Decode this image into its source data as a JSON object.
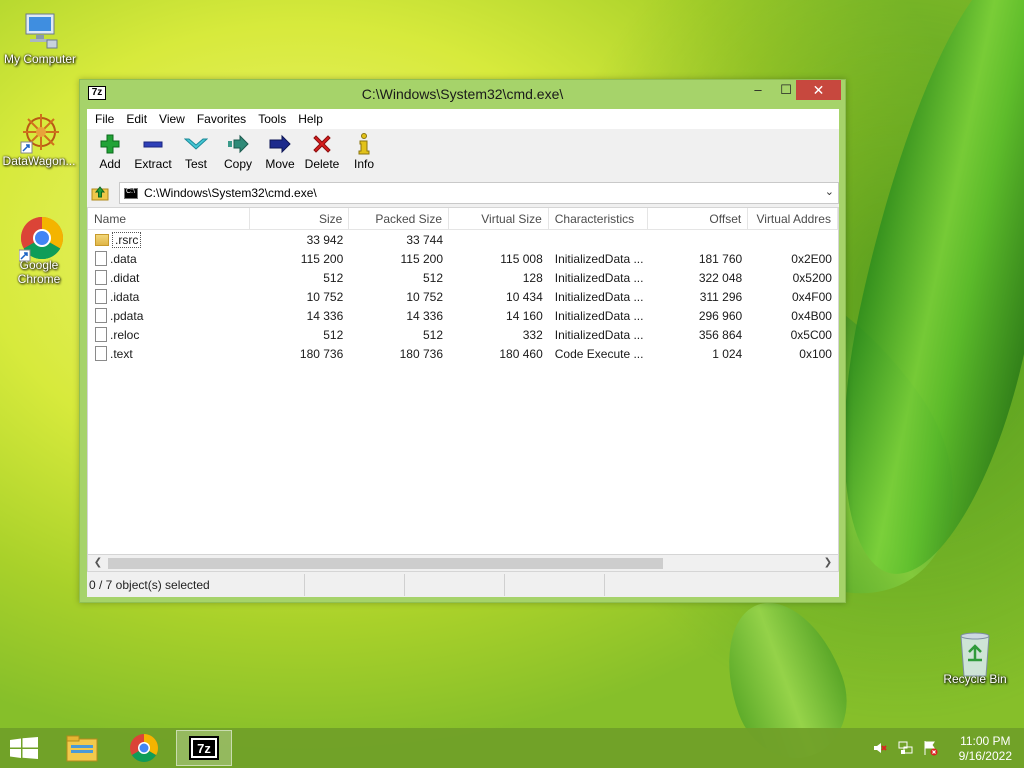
{
  "desktop": {
    "icons": [
      {
        "label": "My Computer"
      },
      {
        "label": "DataWagon..."
      },
      {
        "label": "Google Chrome"
      },
      {
        "label": "Recycle Bin"
      }
    ]
  },
  "window": {
    "title": "C:\\Windows\\System32\\cmd.exe\\",
    "app_icon_text": "7z",
    "controls": {
      "minimize": "–",
      "maximize": "☐",
      "close": "✕"
    }
  },
  "menubar": {
    "items": [
      "File",
      "Edit",
      "View",
      "Favorites",
      "Tools",
      "Help"
    ]
  },
  "toolbar": {
    "buttons": [
      {
        "label": "Add",
        "icon": "plus-icon"
      },
      {
        "label": "Extract",
        "icon": "minus-icon"
      },
      {
        "label": "Test",
        "icon": "check-icon"
      },
      {
        "label": "Copy",
        "icon": "copy-arrow-icon"
      },
      {
        "label": "Move",
        "icon": "move-arrow-icon"
      },
      {
        "label": "Delete",
        "icon": "delete-x-icon"
      },
      {
        "label": "Info",
        "icon": "info-icon"
      }
    ]
  },
  "address": {
    "path": "C:\\Windows\\System32\\cmd.exe\\"
  },
  "listview": {
    "columns": [
      "Name",
      "Size",
      "Packed Size",
      "Virtual Size",
      "Characteristics",
      "Offset",
      "Virtual Addres"
    ],
    "rows": [
      {
        "name": ".rsrc",
        "type": "folder",
        "size": "33 942",
        "packed": "33 744",
        "vsize": "",
        "char": "",
        "offset": "",
        "vaddr": ""
      },
      {
        "name": ".data",
        "type": "file",
        "size": "115 200",
        "packed": "115 200",
        "vsize": "115 008",
        "char": "InitializedData ...",
        "offset": "181 760",
        "vaddr": "0x2E00"
      },
      {
        "name": ".didat",
        "type": "file",
        "size": "512",
        "packed": "512",
        "vsize": "128",
        "char": "InitializedData ...",
        "offset": "322 048",
        "vaddr": "0x5200"
      },
      {
        "name": ".idata",
        "type": "file",
        "size": "10 752",
        "packed": "10 752",
        "vsize": "10 434",
        "char": "InitializedData ...",
        "offset": "311 296",
        "vaddr": "0x4F00"
      },
      {
        "name": ".pdata",
        "type": "file",
        "size": "14 336",
        "packed": "14 336",
        "vsize": "14 160",
        "char": "InitializedData ...",
        "offset": "296 960",
        "vaddr": "0x4B00"
      },
      {
        "name": ".reloc",
        "type": "file",
        "size": "512",
        "packed": "512",
        "vsize": "332",
        "char": "InitializedData ...",
        "offset": "356 864",
        "vaddr": "0x5C00"
      },
      {
        "name": ".text",
        "type": "file",
        "size": "180 736",
        "packed": "180 736",
        "vsize": "180 460",
        "char": "Code Execute ...",
        "offset": "1 024",
        "vaddr": "0x100"
      }
    ]
  },
  "statusbar": {
    "selection": "0 / 7 object(s) selected"
  },
  "taskbar": {
    "time": "11:00 PM",
    "date": "9/16/2022",
    "apps": [
      "file-explorer-icon",
      "chrome-icon",
      "7zip-icon"
    ]
  },
  "colors": {
    "close_button": "#c7483e",
    "window_frame": "#a6d36a",
    "taskbar": "#70a028"
  }
}
